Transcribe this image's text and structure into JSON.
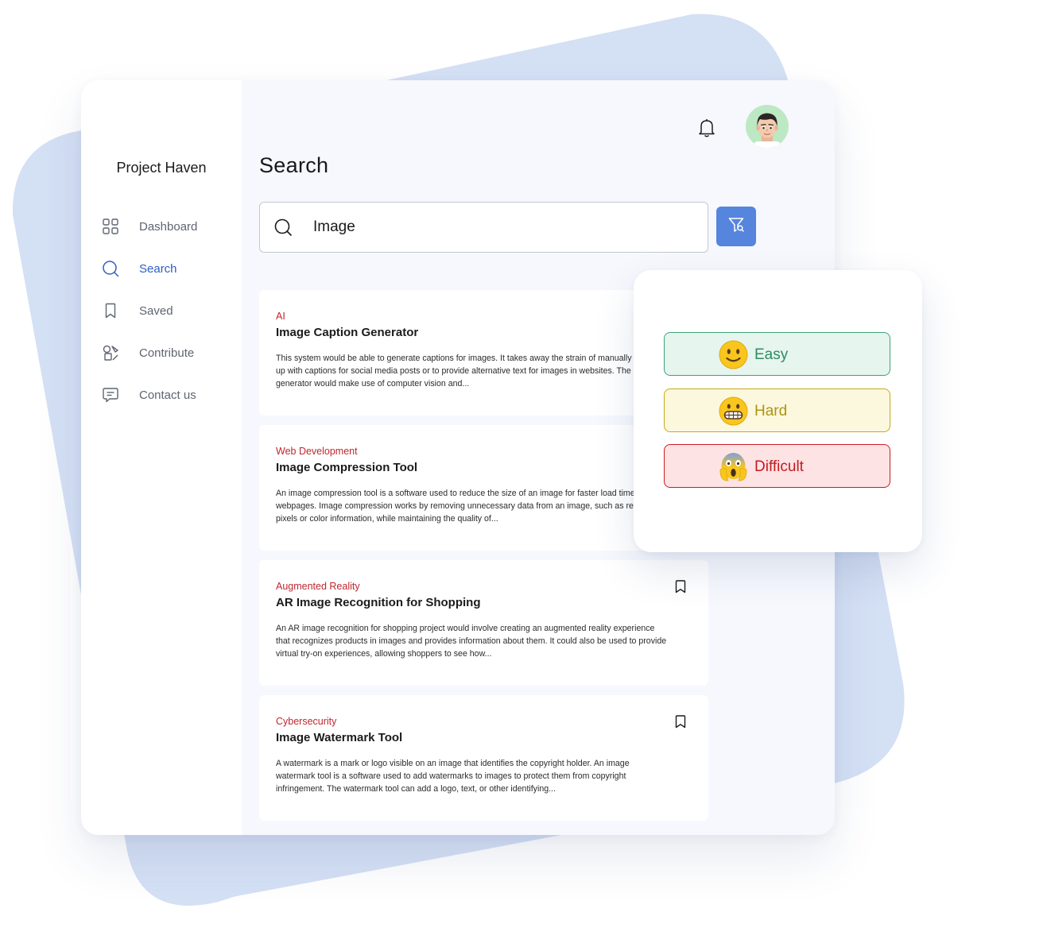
{
  "theme": {
    "accent": "#5585dd",
    "active_nav": "#2d5fc4",
    "category": "#c0262d",
    "backdrop": "#d4e0f4"
  },
  "app": {
    "name": "Project Haven"
  },
  "sidebar": {
    "items": [
      {
        "label": "Dashboard",
        "icon": "grid-icon",
        "active": false
      },
      {
        "label": "Search",
        "icon": "search-icon",
        "active": true
      },
      {
        "label": "Saved",
        "icon": "bookmark-icon",
        "active": false
      },
      {
        "label": "Contribute",
        "icon": "shapes-icon",
        "active": false
      },
      {
        "label": "Contact us",
        "icon": "chat-icon",
        "active": false
      }
    ]
  },
  "header": {
    "notification_icon": "bell-icon",
    "avatar_icon": "memoji-avatar"
  },
  "search": {
    "title": "Search",
    "query": "Image",
    "filter_icon": "filter-icon"
  },
  "results": [
    {
      "category": "AI",
      "title": "Image Caption Generator",
      "description": "This system would be able to generate captions for images. It takes away the strain of manually coming up with captions for social media posts or to provide alternative text for images in websites. The caption generator would make use of computer vision and..."
    },
    {
      "category": "Web Development",
      "title": "Image Compression Tool",
      "description": "An image compression tool is a software used to reduce the size of an image for faster load times on webpages. Image compression works by removing unnecessary data from an image, such as redundant pixels or color information, while maintaining the quality of..."
    },
    {
      "category": "Augmented Reality",
      "title": "AR Image Recognition for Shopping",
      "description": "An AR image recognition for shopping project would involve creating an augmented reality experience that recognizes products in images and provides information about them. It could also be used to provide virtual try-on experiences, allowing shoppers to see how..."
    },
    {
      "category": "Cybersecurity",
      "title": "Image Watermark Tool",
      "description": "A watermark is a mark or logo visible on an image that identifies the copyright holder. An image watermark tool is a software used to add watermarks to images to protect them from copyright infringement. The watermark tool can add a logo, text, or other identifying..."
    }
  ],
  "difficulty": {
    "options": [
      {
        "label": "Easy",
        "emoji": "slightly-smiling-face",
        "color": "#2f8a63"
      },
      {
        "label": "Hard",
        "emoji": "grimacing-face",
        "color": "#ad9410"
      },
      {
        "label": "Difficult",
        "emoji": "screaming-face",
        "color": "#c21a22"
      }
    ]
  }
}
